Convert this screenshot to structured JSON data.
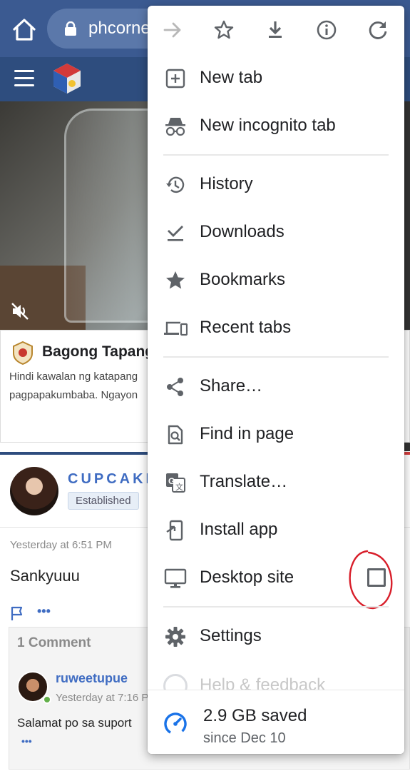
{
  "colors": {
    "toolbar": "#3b5a91",
    "site_header": "#2e4d7e",
    "icon_gray": "#5f6368",
    "accent_blue": "#1a73e8",
    "annotation_red": "#d81e2a",
    "link_blue": "#3f6cc2"
  },
  "browser": {
    "url": "phcorner.net"
  },
  "page": {
    "card_title": "Bagong Tapang",
    "card_line_1": "Hindi kawalan ng katapang",
    "card_line_2": "pagpapakumbaba. Ngayon",
    "username": "CUPCAKE",
    "badge": "Established",
    "post_time": "Yesterday at 6:51 PM",
    "post_body": "Sankyuuu",
    "more": "•••",
    "comment_count": "1 Comment",
    "comment_user": "ruweetupue",
    "comment_time": "Yesterday at 7:16 P",
    "comment_body": "Salamat po sa suport",
    "comment_more": "•••"
  },
  "menu": {
    "top_icons": [
      "forward-icon",
      "bookmark-star-icon",
      "download-icon",
      "info-icon",
      "reload-icon"
    ],
    "items": [
      {
        "label": "New tab",
        "icon": "new-tab-icon"
      },
      {
        "label": "New incognito tab",
        "icon": "incognito-icon"
      },
      {
        "label": "History",
        "icon": "history-icon"
      },
      {
        "label": "Downloads",
        "icon": "downloads-check-icon"
      },
      {
        "label": "Bookmarks",
        "icon": "star-icon"
      },
      {
        "label": "Recent tabs",
        "icon": "devices-icon"
      },
      {
        "label": "Share…",
        "icon": "share-icon"
      },
      {
        "label": "Find in page",
        "icon": "find-in-page-icon"
      },
      {
        "label": "Translate…",
        "icon": "translate-icon"
      },
      {
        "label": "Install app",
        "icon": "install-app-icon"
      },
      {
        "label": "Desktop site",
        "icon": "desktop-icon",
        "checked": false
      },
      {
        "label": "Settings",
        "icon": "settings-gear-icon"
      },
      {
        "label": "Help & feedback",
        "icon": "help-icon"
      }
    ],
    "footer": {
      "saved": "2.9 GB saved",
      "since": "since Dec 10"
    }
  }
}
